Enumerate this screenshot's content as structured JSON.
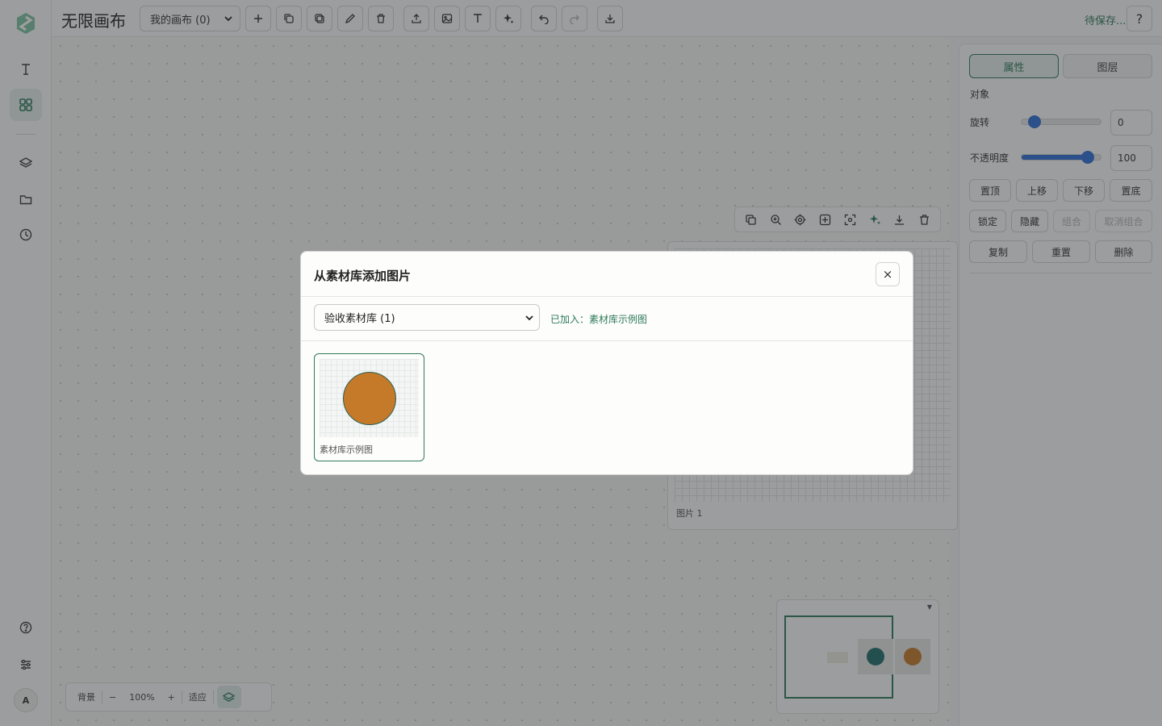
{
  "app": {
    "title": "无限画布"
  },
  "topbar": {
    "canvas_select": "我的画布 (0)",
    "save_status": "待保存...",
    "help_label": "?"
  },
  "canvas": {
    "image_caption": "图片 1",
    "zoom": {
      "background_label": "背景",
      "minus": "−",
      "level": "100%",
      "plus": "+",
      "fit_label": "适应"
    }
  },
  "panel": {
    "tabs": [
      "属性",
      "图层"
    ],
    "section_label": "对象",
    "rotate_label": "旋转",
    "rotate_value": "0",
    "rotate_fraction": 0.16,
    "opacity_label": "不透明度",
    "opacity_value": "100",
    "opacity_fraction": 0.84,
    "row1": [
      "置顶",
      "上移",
      "下移",
      "置底"
    ],
    "row2": [
      "锁定",
      "隐藏",
      "组合",
      "取消组合"
    ],
    "row3": [
      "复制",
      "重置",
      "删除"
    ]
  },
  "modal": {
    "title": "从素材库添加图片",
    "close_label": "×",
    "library_select": "验收素材库 (1)",
    "added_text": "已加入：素材库示例图",
    "assets": [
      {
        "name": "素材库示例图"
      }
    ]
  },
  "colors": {
    "accent": "#2e7a58",
    "asset_fill": "#c47a28",
    "teal": "#1f6f6a"
  }
}
